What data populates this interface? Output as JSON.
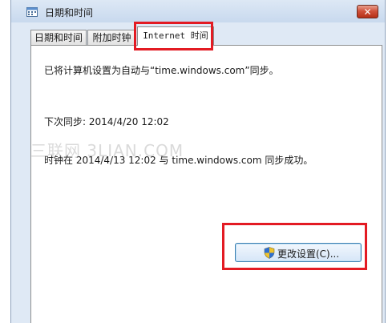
{
  "window": {
    "title": "日期和时间",
    "close_label": "✕"
  },
  "tabs": [
    {
      "label": "日期和时间"
    },
    {
      "label": "附加时钟"
    },
    {
      "label": "Internet 时间"
    }
  ],
  "content": {
    "status": "已将计算机设置为自动与“time.windows.com”同步。",
    "next_sync": "下次同步: 2014/4/20 12:02",
    "last_sync": "时钟在 2014/4/13 12:02 与 time.windows.com 同步成功。"
  },
  "change_button": {
    "label": "更改设置(C)...",
    "icon": "uac-shield-icon"
  },
  "watermark": "三联网 3LIAN.COM",
  "colors": {
    "highlight": "#e31b23",
    "accent": "#3c7fb1"
  }
}
